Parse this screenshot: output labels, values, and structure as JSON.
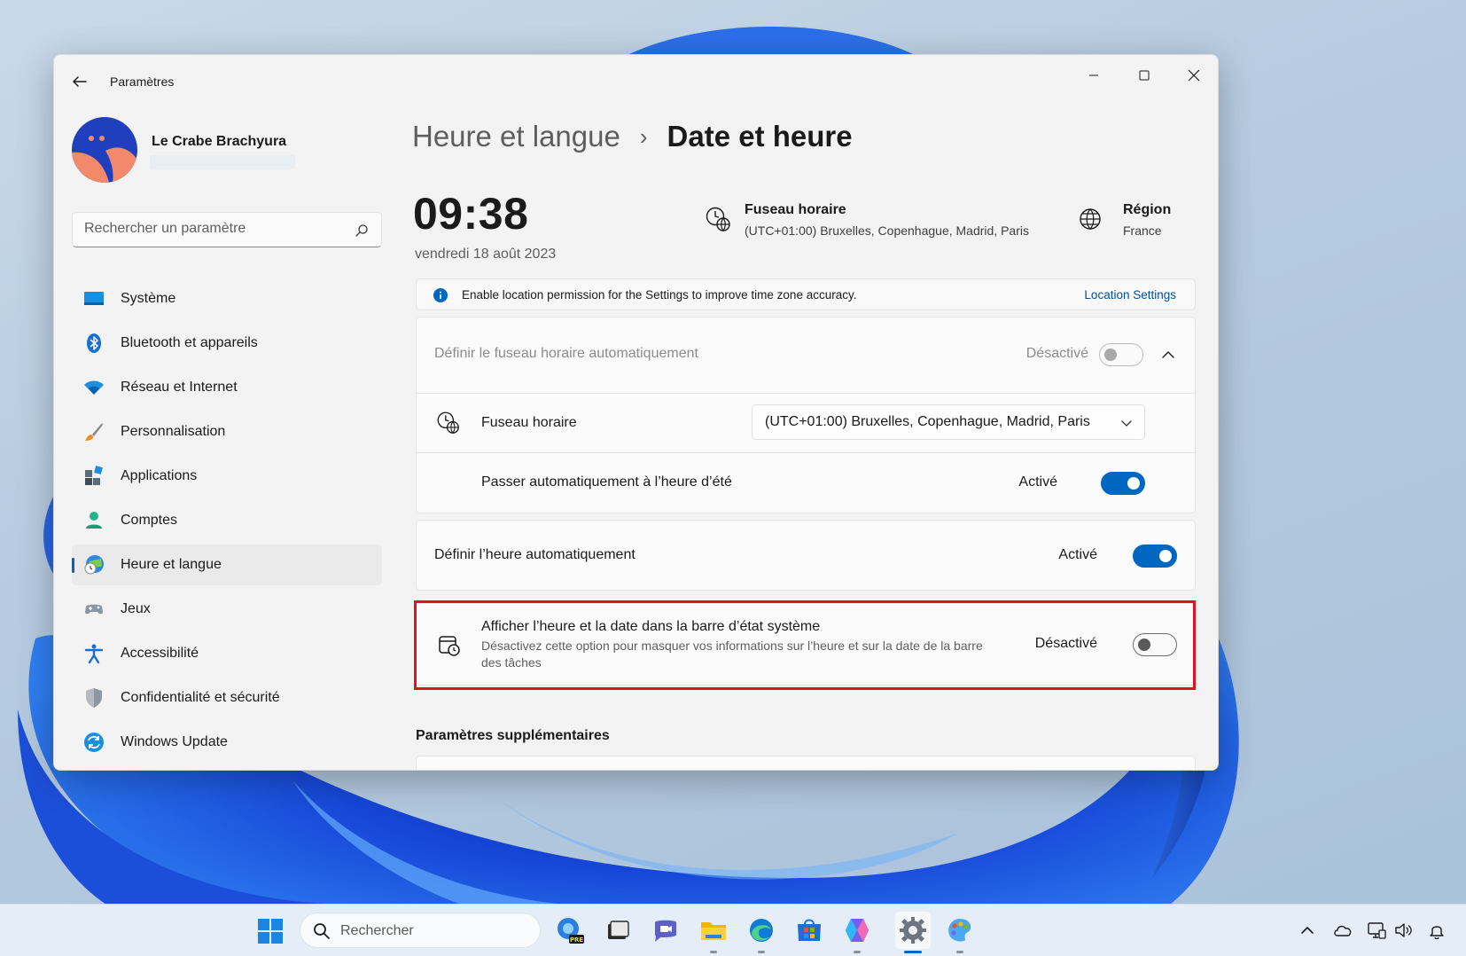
{
  "window": {
    "app_title": "Paramètres"
  },
  "profile": {
    "name": "Le Crabe Brachyura"
  },
  "search": {
    "placeholder": "Rechercher un paramètre"
  },
  "nav": [
    {
      "label": "Système",
      "icon": "monitor-icon"
    },
    {
      "label": "Bluetooth et appareils",
      "icon": "bluetooth-icon"
    },
    {
      "label": "Réseau et Internet",
      "icon": "wifi-icon"
    },
    {
      "label": "Personnalisation",
      "icon": "brush-icon"
    },
    {
      "label": "Applications",
      "icon": "apps-icon"
    },
    {
      "label": "Comptes",
      "icon": "person-icon"
    },
    {
      "label": "Heure et langue",
      "icon": "time-globe-icon",
      "active": true
    },
    {
      "label": "Jeux",
      "icon": "gamepad-icon"
    },
    {
      "label": "Accessibilité",
      "icon": "accessibility-icon"
    },
    {
      "label": "Confidentialité et sécurité",
      "icon": "shield-icon"
    },
    {
      "label": "Windows Update",
      "icon": "update-icon"
    }
  ],
  "breadcrumb": {
    "parent": "Heure et langue",
    "separator": "›",
    "current": "Date et heure"
  },
  "clock": {
    "time": "09:38",
    "date": "vendredi 18 août 2023"
  },
  "timezone_summary": {
    "title": "Fuseau horaire",
    "value": "(UTC+01:00) Bruxelles, Copenhague, Madrid, Paris"
  },
  "region_summary": {
    "title": "Région",
    "value": "France"
  },
  "infobar": {
    "text": "Enable location permission for the Settings to improve time zone accuracy.",
    "link": "Location Settings"
  },
  "settings": {
    "auto_timezone": {
      "label": "Définir le fuseau horaire automatiquement",
      "state": "Désactivé",
      "on": false,
      "disabled": true
    },
    "timezone": {
      "label": "Fuseau horaire",
      "value": "(UTC+01:00) Bruxelles, Copenhague, Madrid, Paris"
    },
    "dst": {
      "label": "Passer automatiquement à l’heure d’été",
      "state": "Activé",
      "on": true
    },
    "auto_time": {
      "label": "Définir l’heure automatiquement",
      "state": "Activé",
      "on": true
    },
    "show_in_tray": {
      "label": "Afficher l’heure et la date dans la barre d’état système",
      "description_line1": "Désactivez cette option pour masquer vos informations sur l’heure et sur la date de la barre",
      "description_line2": "des tâches",
      "state": "Désactivé",
      "on": false
    }
  },
  "more_settings": {
    "title": "Paramètres supplémentaires"
  },
  "taskbar": {
    "search_label": "Rechercher",
    "apps": [
      "start-icon",
      "copilot-preview-icon",
      "task-view-icon",
      "teams-chat-icon",
      "file-explorer-icon",
      "edge-icon",
      "store-icon",
      "copilot-icon",
      "settings-icon",
      "paint-icon"
    ],
    "tray": [
      "chevron-up-icon",
      "onedrive-icon",
      "network-icon",
      "volume-icon",
      "notification-bell-icon"
    ]
  },
  "colors": {
    "accent": "#0067c0",
    "highlight_border": "#e0141e"
  }
}
